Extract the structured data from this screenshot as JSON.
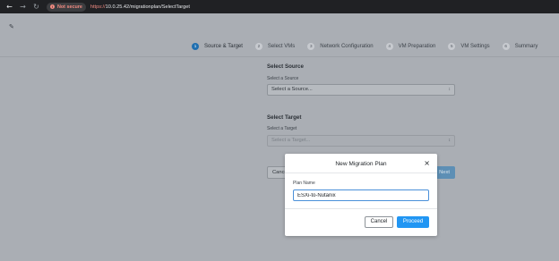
{
  "browser": {
    "back_icon": "arrow-left-icon",
    "forward_icon": "arrow-right-icon",
    "reload_icon": "reload-icon",
    "security_label": "Not secure",
    "url_protocol": "https://",
    "url_rest": "10.0.25.42/migrationplan/SelectTarget"
  },
  "stepper": {
    "steps": [
      {
        "num": "1",
        "label": "Source & Target"
      },
      {
        "num": "2",
        "label": "Select VMs"
      },
      {
        "num": "3",
        "label": "Network Configuration"
      },
      {
        "num": "4",
        "label": "VM Preparation"
      },
      {
        "num": "5",
        "label": "VM Settings"
      },
      {
        "num": "6",
        "label": "Summary"
      }
    ]
  },
  "source": {
    "title": "Select Source",
    "label": "Select a Source",
    "value": "Select a Source..."
  },
  "target": {
    "title": "Select Target",
    "label": "Select a Target",
    "value": "Select a Target..."
  },
  "footer": {
    "cancel_label": "Cancel",
    "next_label": "Next"
  },
  "modal": {
    "title": "New Migration Plan",
    "close_glyph": "×",
    "plan_name_label": "Plan Name",
    "plan_name_value": "ESXi-to-Nutanix",
    "cancel_label": "Cancel",
    "proceed_label": "Proceed"
  },
  "colors": {
    "accent": "#2196f3",
    "active_step": "#1f6fb0",
    "overlay_bg": "#aaaeb4",
    "not_secure": "#f28b82"
  }
}
